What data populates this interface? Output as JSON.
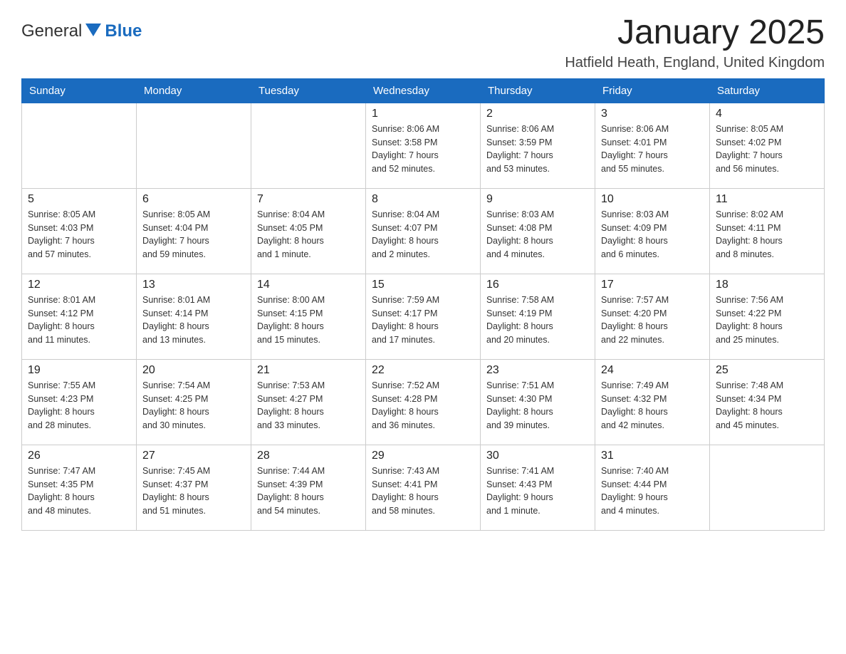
{
  "header": {
    "logo_general": "General",
    "logo_blue": "Blue",
    "title": "January 2025",
    "subtitle": "Hatfield Heath, England, United Kingdom"
  },
  "columns": [
    "Sunday",
    "Monday",
    "Tuesday",
    "Wednesday",
    "Thursday",
    "Friday",
    "Saturday"
  ],
  "weeks": [
    [
      {
        "day": "",
        "info": ""
      },
      {
        "day": "",
        "info": ""
      },
      {
        "day": "",
        "info": ""
      },
      {
        "day": "1",
        "info": "Sunrise: 8:06 AM\nSunset: 3:58 PM\nDaylight: 7 hours\nand 52 minutes."
      },
      {
        "day": "2",
        "info": "Sunrise: 8:06 AM\nSunset: 3:59 PM\nDaylight: 7 hours\nand 53 minutes."
      },
      {
        "day": "3",
        "info": "Sunrise: 8:06 AM\nSunset: 4:01 PM\nDaylight: 7 hours\nand 55 minutes."
      },
      {
        "day": "4",
        "info": "Sunrise: 8:05 AM\nSunset: 4:02 PM\nDaylight: 7 hours\nand 56 minutes."
      }
    ],
    [
      {
        "day": "5",
        "info": "Sunrise: 8:05 AM\nSunset: 4:03 PM\nDaylight: 7 hours\nand 57 minutes."
      },
      {
        "day": "6",
        "info": "Sunrise: 8:05 AM\nSunset: 4:04 PM\nDaylight: 7 hours\nand 59 minutes."
      },
      {
        "day": "7",
        "info": "Sunrise: 8:04 AM\nSunset: 4:05 PM\nDaylight: 8 hours\nand 1 minute."
      },
      {
        "day": "8",
        "info": "Sunrise: 8:04 AM\nSunset: 4:07 PM\nDaylight: 8 hours\nand 2 minutes."
      },
      {
        "day": "9",
        "info": "Sunrise: 8:03 AM\nSunset: 4:08 PM\nDaylight: 8 hours\nand 4 minutes."
      },
      {
        "day": "10",
        "info": "Sunrise: 8:03 AM\nSunset: 4:09 PM\nDaylight: 8 hours\nand 6 minutes."
      },
      {
        "day": "11",
        "info": "Sunrise: 8:02 AM\nSunset: 4:11 PM\nDaylight: 8 hours\nand 8 minutes."
      }
    ],
    [
      {
        "day": "12",
        "info": "Sunrise: 8:01 AM\nSunset: 4:12 PM\nDaylight: 8 hours\nand 11 minutes."
      },
      {
        "day": "13",
        "info": "Sunrise: 8:01 AM\nSunset: 4:14 PM\nDaylight: 8 hours\nand 13 minutes."
      },
      {
        "day": "14",
        "info": "Sunrise: 8:00 AM\nSunset: 4:15 PM\nDaylight: 8 hours\nand 15 minutes."
      },
      {
        "day": "15",
        "info": "Sunrise: 7:59 AM\nSunset: 4:17 PM\nDaylight: 8 hours\nand 17 minutes."
      },
      {
        "day": "16",
        "info": "Sunrise: 7:58 AM\nSunset: 4:19 PM\nDaylight: 8 hours\nand 20 minutes."
      },
      {
        "day": "17",
        "info": "Sunrise: 7:57 AM\nSunset: 4:20 PM\nDaylight: 8 hours\nand 22 minutes."
      },
      {
        "day": "18",
        "info": "Sunrise: 7:56 AM\nSunset: 4:22 PM\nDaylight: 8 hours\nand 25 minutes."
      }
    ],
    [
      {
        "day": "19",
        "info": "Sunrise: 7:55 AM\nSunset: 4:23 PM\nDaylight: 8 hours\nand 28 minutes."
      },
      {
        "day": "20",
        "info": "Sunrise: 7:54 AM\nSunset: 4:25 PM\nDaylight: 8 hours\nand 30 minutes."
      },
      {
        "day": "21",
        "info": "Sunrise: 7:53 AM\nSunset: 4:27 PM\nDaylight: 8 hours\nand 33 minutes."
      },
      {
        "day": "22",
        "info": "Sunrise: 7:52 AM\nSunset: 4:28 PM\nDaylight: 8 hours\nand 36 minutes."
      },
      {
        "day": "23",
        "info": "Sunrise: 7:51 AM\nSunset: 4:30 PM\nDaylight: 8 hours\nand 39 minutes."
      },
      {
        "day": "24",
        "info": "Sunrise: 7:49 AM\nSunset: 4:32 PM\nDaylight: 8 hours\nand 42 minutes."
      },
      {
        "day": "25",
        "info": "Sunrise: 7:48 AM\nSunset: 4:34 PM\nDaylight: 8 hours\nand 45 minutes."
      }
    ],
    [
      {
        "day": "26",
        "info": "Sunrise: 7:47 AM\nSunset: 4:35 PM\nDaylight: 8 hours\nand 48 minutes."
      },
      {
        "day": "27",
        "info": "Sunrise: 7:45 AM\nSunset: 4:37 PM\nDaylight: 8 hours\nand 51 minutes."
      },
      {
        "day": "28",
        "info": "Sunrise: 7:44 AM\nSunset: 4:39 PM\nDaylight: 8 hours\nand 54 minutes."
      },
      {
        "day": "29",
        "info": "Sunrise: 7:43 AM\nSunset: 4:41 PM\nDaylight: 8 hours\nand 58 minutes."
      },
      {
        "day": "30",
        "info": "Sunrise: 7:41 AM\nSunset: 4:43 PM\nDaylight: 9 hours\nand 1 minute."
      },
      {
        "day": "31",
        "info": "Sunrise: 7:40 AM\nSunset: 4:44 PM\nDaylight: 9 hours\nand 4 minutes."
      },
      {
        "day": "",
        "info": ""
      }
    ]
  ]
}
